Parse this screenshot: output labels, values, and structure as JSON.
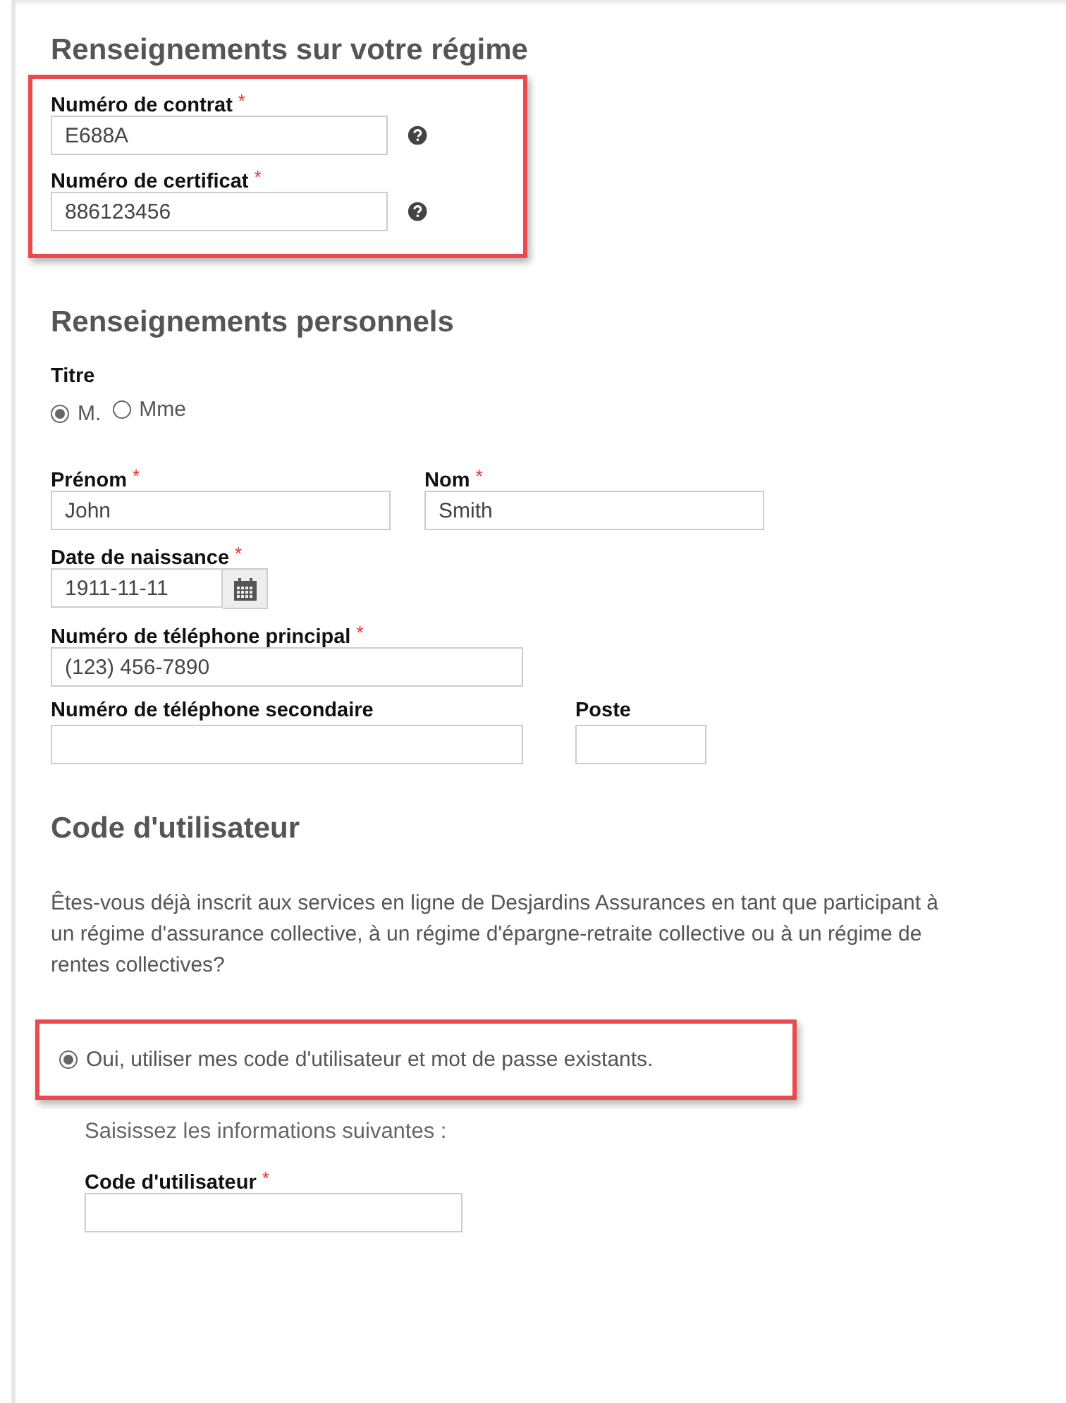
{
  "plan": {
    "heading": "Renseignements sur votre régime",
    "highlighted": true,
    "fields": [
      {
        "label": "Numéro de contrat",
        "mark": "*",
        "value": "E688A",
        "help": true
      },
      {
        "label": "Numéro de certificat",
        "mark": "*",
        "value": "886123456",
        "help": true
      }
    ]
  },
  "personal": {
    "heading": "Renseignements personnels",
    "title": {
      "label": "Titre",
      "options": [
        {
          "label": "M.",
          "selected": true
        },
        {
          "label": "Mme",
          "selected": false
        }
      ]
    },
    "rows": [
      [
        {
          "kind": "name",
          "label": "Prénom",
          "mark": "*",
          "value": "John"
        },
        {
          "kind": "name",
          "label": "Nom",
          "mark": "*",
          "value": "Smith"
        }
      ],
      [
        {
          "kind": "date",
          "label": "Date de naissance",
          "mark": "*",
          "value": "1911-11-11"
        }
      ],
      [
        {
          "kind": "phone",
          "label": "Numéro de téléphone principal",
          "mark": "*",
          "value": "(123) 456-7890"
        }
      ],
      [
        {
          "kind": "phone",
          "label": "Numéro de téléphone secondaire"
        },
        {
          "kind": "ext",
          "label": "Poste"
        }
      ]
    ]
  },
  "user": {
    "heading": "Code d'utilisateur",
    "question": "Êtes-vous déjà inscrit aux services en ligne de Desjardins Assurances en tant que participant à un régime d'assurance collective, à un régime d'épargne-retraite collective ou à un régime de rentes collectives?",
    "option": {
      "label": "Oui, utiliser mes code d'utilisateur et mot de passe existants.",
      "selected": true,
      "highlighted": true
    },
    "instruction": "Saisissez les informations suivantes :",
    "field": {
      "label": "Code d'utilisateur",
      "mark": "*"
    }
  }
}
